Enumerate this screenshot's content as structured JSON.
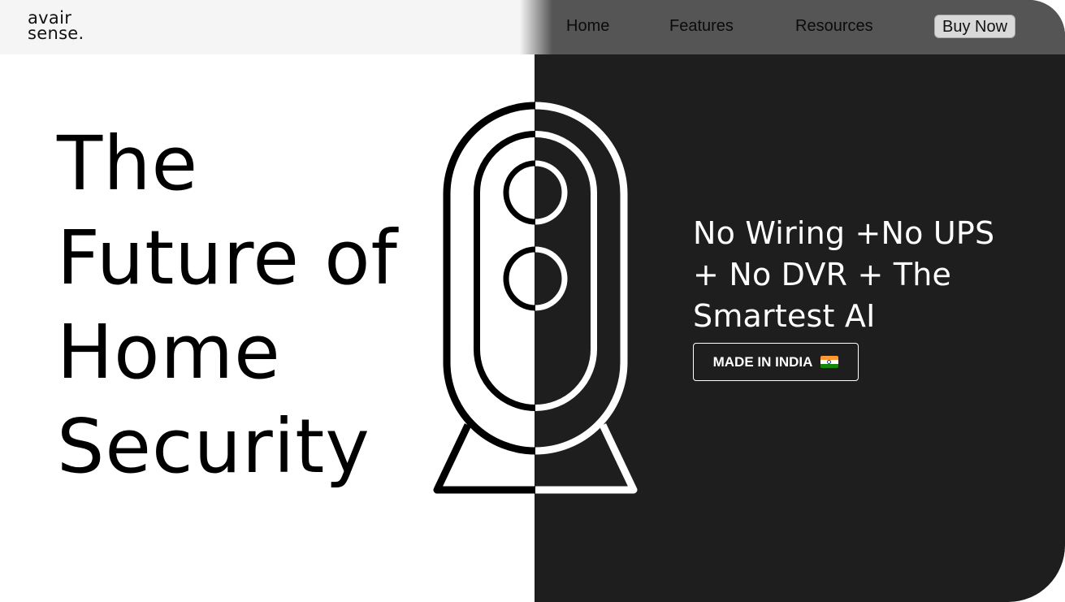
{
  "brand": {
    "logo_line1": "avair",
    "logo_line2": "sense."
  },
  "nav": {
    "items": [
      {
        "label": "Home"
      },
      {
        "label": "Features"
      },
      {
        "label": "Resources"
      }
    ],
    "cta_label": "Buy Now"
  },
  "hero": {
    "headline_lines": [
      "The",
      "Future of",
      "Home",
      "Security"
    ],
    "tagline_lines": [
      "No Wiring +No UPS",
      "+ No DVR + The",
      "Smartest AI"
    ],
    "badge_label": "MADE IN INDIA",
    "badge_icon": "india-flag-icon"
  },
  "colors": {
    "left_bg": "#ffffff",
    "right_bg": "#1e1e1e",
    "nav_left_bg": "#f5f5f5",
    "nav_right_bg": "#555555"
  }
}
